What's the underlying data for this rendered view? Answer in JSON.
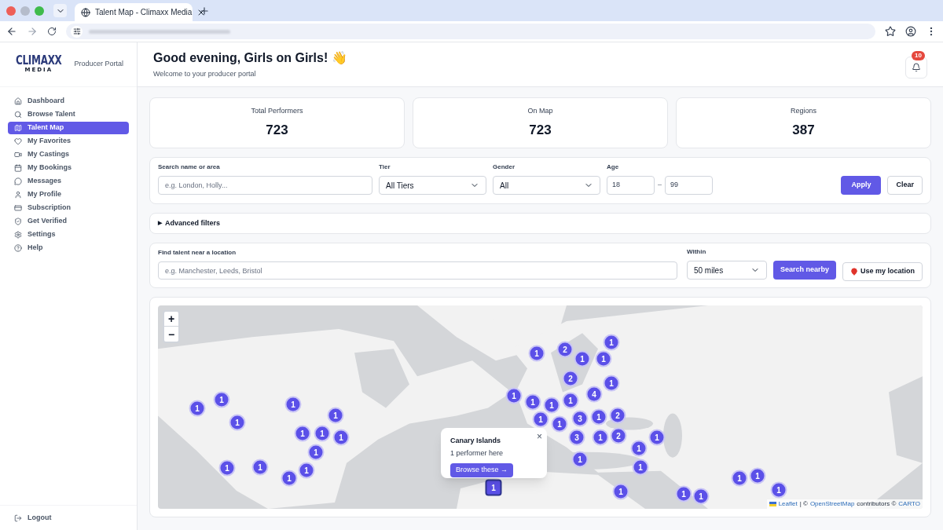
{
  "browser": {
    "tab_title": "Talent Map - Climaxx Media"
  },
  "sidebar": {
    "logo_top": "CLIMAXX",
    "logo_bottom": "MEDIA",
    "subtitle": "Producer Portal",
    "items": [
      {
        "label": "Dashboard",
        "selected": false
      },
      {
        "label": "Browse Talent",
        "selected": false
      },
      {
        "label": "Talent Map",
        "selected": true
      },
      {
        "label": "My Favorites",
        "selected": false
      },
      {
        "label": "My Castings",
        "selected": false
      },
      {
        "label": "My Bookings",
        "selected": false
      },
      {
        "label": "Messages",
        "selected": false
      },
      {
        "label": "My Profile",
        "selected": false
      },
      {
        "label": "Subscription",
        "selected": false
      },
      {
        "label": "Get Verified",
        "selected": false
      },
      {
        "label": "Settings",
        "selected": false
      },
      {
        "label": "Help",
        "selected": false
      }
    ],
    "logout": "Logout"
  },
  "header": {
    "greeting": "Good evening, Girls on Girls! 👋",
    "subtitle": "Welcome to your producer portal",
    "notification_count": "10"
  },
  "stats": [
    {
      "label": "Total Performers",
      "value": "723"
    },
    {
      "label": "On Map",
      "value": "723"
    },
    {
      "label": "Regions",
      "value": "387"
    }
  ],
  "filters": {
    "search_label": "Search name or area",
    "search_placeholder": "e.g. London, Holly...",
    "tier_label": "Tier",
    "tier_value": "All Tiers",
    "gender_label": "Gender",
    "gender_value": "All",
    "age_label": "Age",
    "age_min": "18",
    "age_separator": "–",
    "age_max": "99",
    "apply": "Apply",
    "clear": "Clear"
  },
  "advanced_filters": {
    "marker": "▶",
    "label": "Advanced filters"
  },
  "location_search": {
    "label": "Find talent near a location",
    "placeholder": "e.g. Manchester, Leeds, Bristol",
    "within_label": "Within",
    "within_value": "50 miles",
    "search_button": "Search nearby",
    "location_button": "Use my location"
  },
  "map": {
    "zoom_in": "+",
    "zoom_out": "−",
    "markers": [
      {
        "label": "1",
        "selected": false
      },
      {
        "label": "1",
        "selected": false
      },
      {
        "label": "1",
        "selected": false
      },
      {
        "label": "1",
        "selected": false
      },
      {
        "label": "1",
        "selected": false
      },
      {
        "label": "1",
        "selected": false
      },
      {
        "label": "1",
        "selected": false
      },
      {
        "label": "1",
        "selected": false
      },
      {
        "label": "1",
        "selected": false
      },
      {
        "label": "1",
        "selected": false
      },
      {
        "label": "1",
        "selected": false
      },
      {
        "label": "1",
        "selected": false
      },
      {
        "label": "1",
        "selected": false
      },
      {
        "label": "1",
        "selected": true
      },
      {
        "label": "1",
        "selected": false
      },
      {
        "label": "1",
        "selected": false
      },
      {
        "label": "1",
        "selected": false
      },
      {
        "label": "1",
        "selected": false
      },
      {
        "label": "1",
        "selected": false
      },
      {
        "label": "1",
        "selected": false
      },
      {
        "label": "2",
        "selected": false
      },
      {
        "label": "2",
        "selected": false
      },
      {
        "label": "1",
        "selected": false
      },
      {
        "label": "3",
        "selected": false
      },
      {
        "label": "3",
        "selected": false
      },
      {
        "label": "1",
        "selected": false
      },
      {
        "label": "1",
        "selected": false
      },
      {
        "label": "4",
        "selected": false
      },
      {
        "label": "1",
        "selected": false
      },
      {
        "label": "1",
        "selected": false
      },
      {
        "label": "1",
        "selected": false
      },
      {
        "label": "1",
        "selected": false
      },
      {
        "label": "1",
        "selected": false
      },
      {
        "label": "2",
        "selected": false
      },
      {
        "label": "2",
        "selected": false
      },
      {
        "label": "1",
        "selected": false
      },
      {
        "label": "1",
        "selected": false
      },
      {
        "label": "1",
        "selected": false
      },
      {
        "label": "1",
        "selected": false
      },
      {
        "label": "1",
        "selected": false
      },
      {
        "label": "1",
        "selected": false
      },
      {
        "label": "1",
        "selected": false
      },
      {
        "label": "1",
        "selected": false
      },
      {
        "label": "1",
        "selected": false
      }
    ],
    "popup": {
      "title": "Canary Islands",
      "subtitle": "1 performer here",
      "button": "Browse these →",
      "close": "×"
    },
    "attribution": {
      "leaflet": "Leaflet",
      "separator": "| ©",
      "osm": "OpenStreetMap",
      "contributors": "contributors ©",
      "carto": "CARTO"
    }
  }
}
